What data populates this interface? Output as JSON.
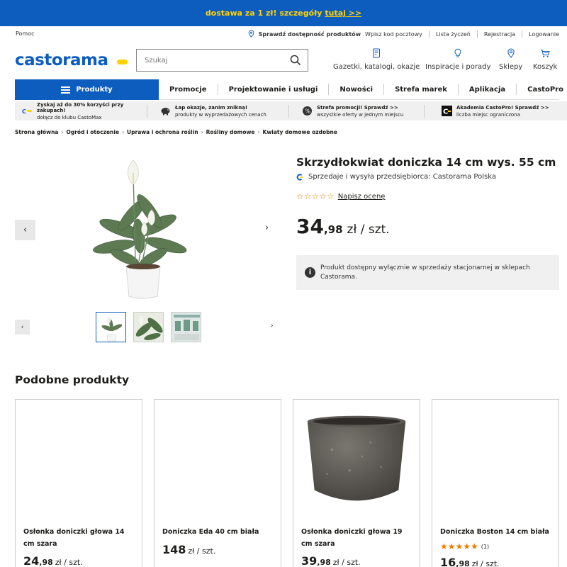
{
  "promo": {
    "text": "dostawa za 1 zł! szczegóły",
    "link": "tutaj >>"
  },
  "utility": {
    "help": "Pomoc",
    "check_availability": "Sprawdź dostępność produktów",
    "postal_code": "Wpisz kod pocztowy",
    "wishlist": "Lista życzeń",
    "register": "Rejestracja",
    "login": "Logowanie"
  },
  "logo": {
    "text": "castorama",
    "accent": "#ffd200",
    "brand": "#0d5dbf"
  },
  "search": {
    "placeholder": "Szukaj"
  },
  "header_icons": [
    {
      "label": "Gazetki, katalogi, okazje",
      "icon": "catalog-icon"
    },
    {
      "label": "Inspiracje i porady",
      "icon": "lightbulb-icon"
    },
    {
      "label": "Sklepy",
      "icon": "location-pin-icon"
    },
    {
      "label": "Koszyk",
      "icon": "cart-icon"
    }
  ],
  "nav": {
    "products": "Produkty",
    "items": [
      "Promocje",
      "Projektowanie i usługi",
      "Nowości",
      "Strefa marek",
      "Aplikacja",
      "CastoPro"
    ]
  },
  "benefits": [
    {
      "title": "Zyskaj aż do 30% korzyści przy zakupach!",
      "sub": "dołącz do klubu CastoMax",
      "icon": "castomax-icon"
    },
    {
      "title": "Łap okazje, zanim znikną!",
      "sub": "produkty w wyprzedażowych cenach",
      "icon": "piggy-bank-icon"
    },
    {
      "title": "Strefa promocji! Sprawdź >>",
      "sub": "wszystkie oferty w jednym miejscu",
      "icon": "promo-badge-icon"
    },
    {
      "title": "Akademia CastoPro! Sprawdź >>",
      "sub": "liczba miejsc ograniczona",
      "icon": "castopro-icon"
    }
  ],
  "breadcrumb": [
    "Strona główna",
    "Ogród i otoczenie",
    "Uprawa i ochrona roślin",
    "Rośliny domowe",
    "Kwiaty domowe ozdobne"
  ],
  "product": {
    "title": "Skrzydłokwiat doniczka 14 cm wys. 55 cm",
    "seller": "Sprzedaje i wysyła przedsiębiorca: Castorama Polska",
    "rating_stars": "☆☆☆☆☆",
    "rate_link": "Napisz ocenę",
    "price_int": "34",
    "price_dec": ",98",
    "price_unit": "zł / szt.",
    "info": "Produkt dostępny wyłącznie w sprzedaży stacjonarnej w sklepach Castorama."
  },
  "similar": {
    "title": "Podobne produkty",
    "cards": [
      {
        "name": "Osłonka doniczki głowa 14 cm szara",
        "price_int": "24",
        "price_dec": ",98",
        "unit": "zł / szt."
      },
      {
        "name": "Doniczka Eda 40 cm biała",
        "price_int": "148",
        "price_dec": "",
        "unit": "zł / szt."
      },
      {
        "name": "Osłonka doniczki głowa 19 cm szara",
        "price_int": "39",
        "price_dec": ",98",
        "unit": "zł / szt."
      },
      {
        "name": "Doniczka Boston 14 cm biała",
        "price_int": "16",
        "price_dec": ",98",
        "unit": "zł / szt.",
        "stars": "★★★★★",
        "reviews": "(1)"
      }
    ]
  }
}
